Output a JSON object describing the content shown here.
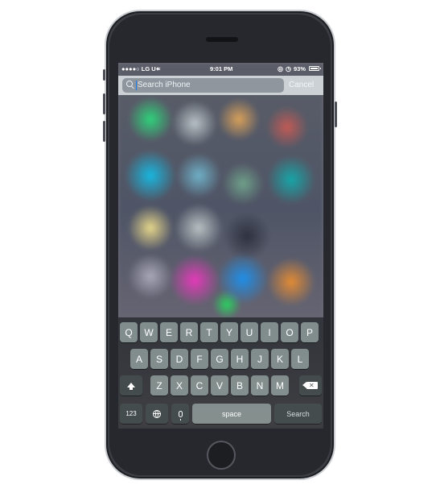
{
  "status_bar": {
    "carrier": "●●●●○ LG U+",
    "time": "9:01 PM",
    "battery": "93%"
  },
  "search": {
    "placeholder": "Search iPhone",
    "cancel_label": "Cancel"
  },
  "keyboard": {
    "row1": [
      "Q",
      "W",
      "E",
      "R",
      "T",
      "Y",
      "U",
      "I",
      "O",
      "P"
    ],
    "row2": [
      "A",
      "S",
      "D",
      "F",
      "G",
      "H",
      "J",
      "K",
      "L"
    ],
    "row3": [
      "Z",
      "X",
      "C",
      "V",
      "B",
      "N",
      "M"
    ],
    "numbers_label": "123",
    "space_label": "space",
    "search_label": "Search"
  },
  "icons": {
    "wifi": "wifi-icon",
    "lock": "rotation-lock-icon",
    "alarm": "alarm-icon",
    "battery": "battery-icon",
    "search": "search-icon",
    "shift": "shift-icon",
    "delete": "backspace-icon",
    "globe": "globe-icon",
    "mic": "microphone-icon"
  },
  "colors": {
    "cursor": "#1b7cf2",
    "phone_body": "#3a3d44"
  }
}
